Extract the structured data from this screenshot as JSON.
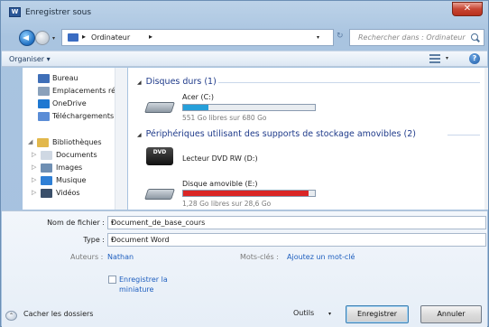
{
  "window": {
    "title": "Enregistrer sous",
    "app_icon_letter": "W",
    "close_glyph": "✕"
  },
  "address": {
    "separator": "▸",
    "location": "Ordinateur",
    "dropdown_glyph": "▾",
    "refresh_glyph": "↻",
    "search_placeholder": "Rechercher dans : Ordinateur"
  },
  "toolbar": {
    "organiser_label": "Organiser ▾",
    "view_dropdown_glyph": "▾",
    "help_glyph": "?"
  },
  "sidebar": {
    "items": [
      {
        "label": "Bureau",
        "icon": "desktop-icon",
        "color": "#3f6fb8",
        "expander": ""
      },
      {
        "label": "Emplacements ré",
        "icon": "recent-places-icon",
        "color": "#8aa1bb",
        "expander": ""
      },
      {
        "label": "OneDrive",
        "icon": "onedrive-icon",
        "color": "#1f78d1",
        "expander": ""
      },
      {
        "label": "Téléchargements",
        "icon": "downloads-icon",
        "color": "#5b8dd6",
        "expander": ""
      },
      {
        "label": "Bibliothèques",
        "icon": "libraries-icon",
        "color": "#e2b84c",
        "expander": "◢"
      },
      {
        "label": "Documents",
        "icon": "documents-icon",
        "color": "#cfd8e3",
        "expander": "▷"
      },
      {
        "label": "Images",
        "icon": "images-icon",
        "color": "#6f8fb3",
        "expander": "▷"
      },
      {
        "label": "Musique",
        "icon": "music-icon",
        "color": "#2e7fd6",
        "expander": "▷"
      },
      {
        "label": "Vidéos",
        "icon": "videos-icon",
        "color": "#3a4f6a",
        "expander": "▷"
      }
    ]
  },
  "content": {
    "group_hard_drives": "Disques durs (1)",
    "group_removable": "Périphériques utilisant des supports de stockage amovibles (2)",
    "group_toggle_glyph": "◢",
    "drives": [
      {
        "name": "Acer (C:)",
        "free_text": "551 Go libres sur 680 Go",
        "used_fraction": 0.19,
        "bar_color": "#26a0da"
      },
      {
        "name": "Lecteur DVD RW (D:)",
        "icon_text": "DVD"
      },
      {
        "name": "Disque amovible (E:)",
        "free_text": "1,28 Go libres sur 28,6 Go",
        "used_fraction": 0.955,
        "bar_color": "#da2626"
      }
    ]
  },
  "form": {
    "filename_label": "Nom de fichier :",
    "filename_value": "Document_de_base_cours",
    "type_label": "Type :",
    "type_value": "Document Word",
    "authors_label": "Auteurs :",
    "authors_value": "Nathan",
    "tags_label": "Mots-clés :",
    "tags_value": "Ajoutez un mot-clé",
    "thumbnail_label": "Enregistrer la miniature",
    "dropdown_glyph": "▾"
  },
  "footer": {
    "hide_folders_label": "Cacher les dossiers",
    "hide_folders_glyph": "⌃",
    "tools_label": "Outils",
    "tools_dropdown_glyph": "▾",
    "save_label": "Enregistrer",
    "cancel_label": "Annuler"
  }
}
